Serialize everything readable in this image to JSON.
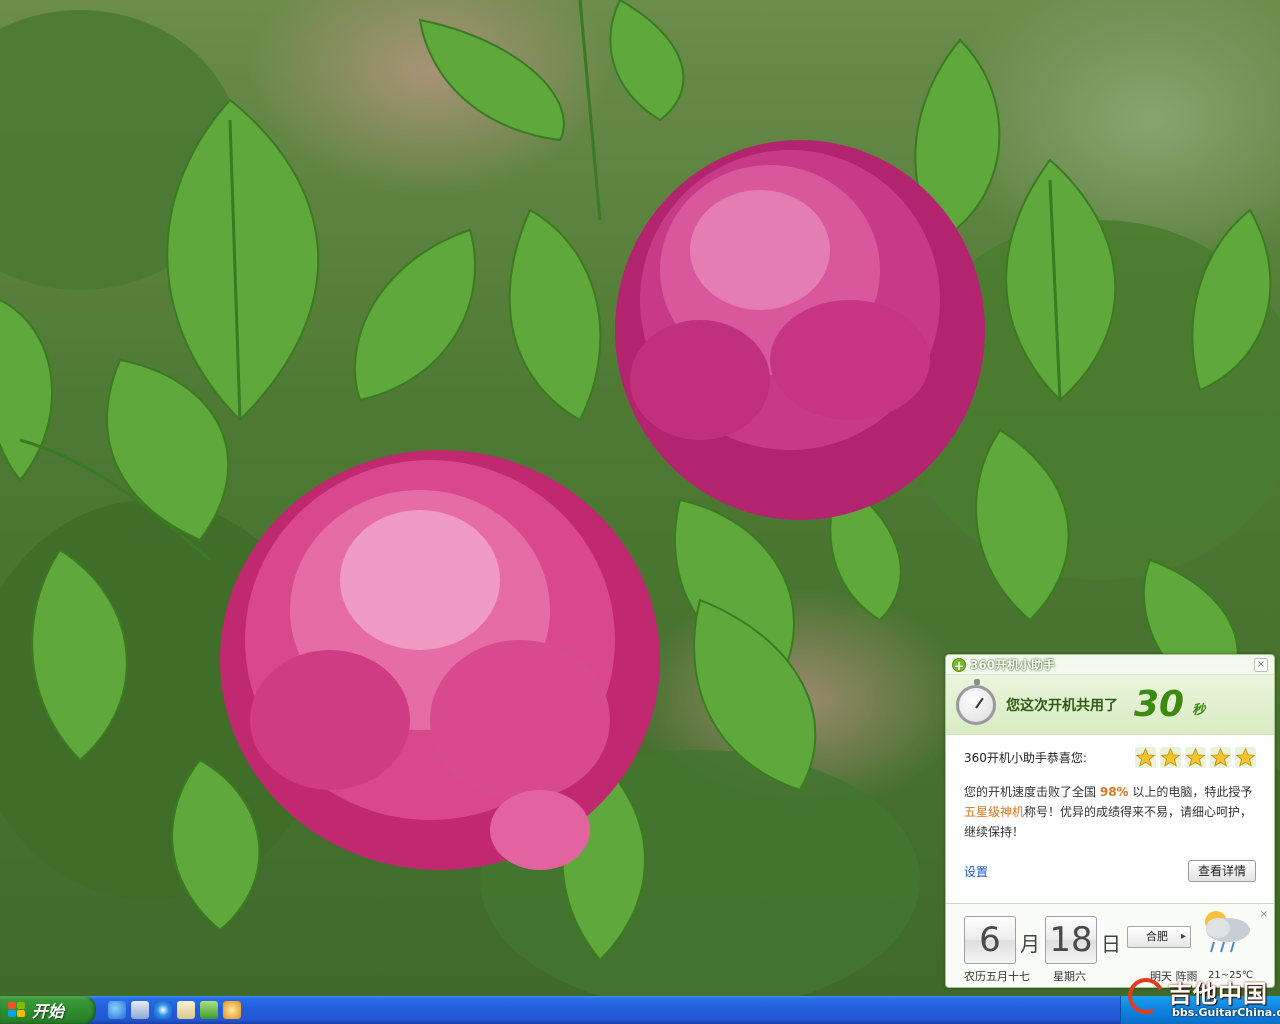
{
  "desktop": {
    "wallpaper": "pink-peony-flowers"
  },
  "widget": {
    "title": "360开机小助手",
    "close_icon": "×",
    "boot_text": "您这次开机共用了",
    "boot_time": "30",
    "boot_unit": "秒",
    "congrats": "360开机小助手恭喜您:",
    "stars": 5,
    "desc_part1": "您的开机速度击败了全国",
    "percent": "98%",
    "desc_part2": "以上的电脑，特此授予",
    "five_star_title": "五星级神机",
    "desc_part3": "称号！优异的成绩得来不易，请细心呵护，继续保持！",
    "settings_link": "设置",
    "details_button": "查看详情",
    "accent_color": "#3d8a12",
    "highlight_color": "#e2761a"
  },
  "calendar": {
    "close_icon": "×",
    "month": "6",
    "month_suffix": "月",
    "day": "18",
    "day_suffix": "日",
    "lunar_date": "农历五月十七",
    "weekday": "星期六",
    "city": "合肥",
    "weather_label": "明天 阵雨",
    "temperature": "21~25℃",
    "weather_icon": "rain-cloud-icon"
  },
  "taskbar": {
    "start_label": "开始",
    "quick_launch": [
      "ie-icon",
      "show-desktop-icon",
      "internet-explorer-icon",
      "outlook-icon",
      "media-player-icon",
      "360-icon"
    ]
  },
  "watermark": {
    "title": "吉他中国",
    "url": "bbs.GuitarChina.com"
  }
}
